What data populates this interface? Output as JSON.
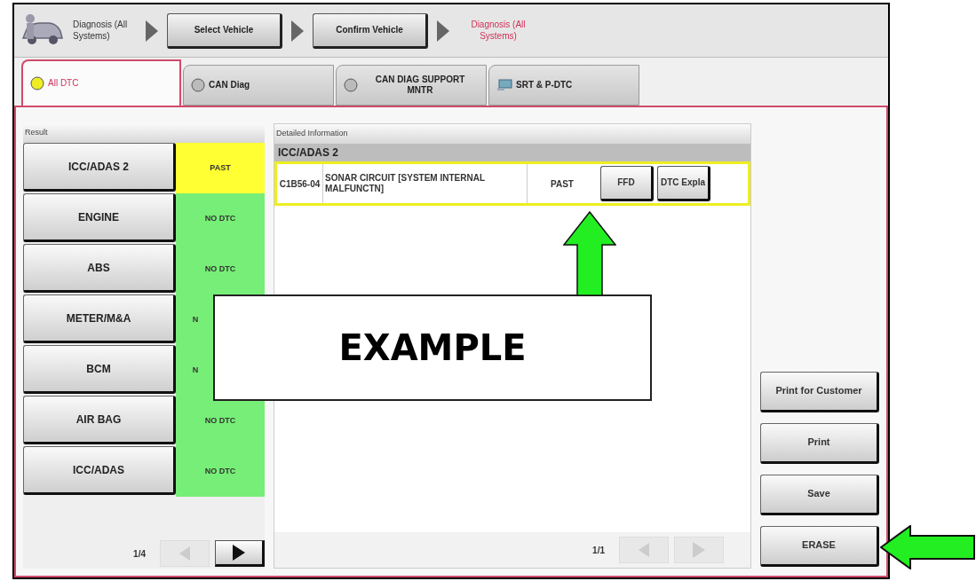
{
  "header": {
    "start_label": "Diagnosis (All Systems)",
    "steps": [
      {
        "label": "Select Vehicle",
        "kind": "button"
      },
      {
        "label": "Confirm Vehicle",
        "kind": "button"
      },
      {
        "label": "Diagnosis (All Systems)",
        "kind": "current"
      }
    ]
  },
  "tabs": [
    {
      "label": "All DTC",
      "selected": true,
      "kind": "lamp"
    },
    {
      "label": "CAN Diag",
      "selected": false,
      "kind": "lamp"
    },
    {
      "label": "CAN DIAG SUPPORT MNTR",
      "selected": false,
      "kind": "lamp"
    },
    {
      "label": "SRT & P-DTC",
      "selected": false,
      "kind": "monitor"
    }
  ],
  "result": {
    "title": "Result",
    "systems": [
      {
        "name": "ICC/ADAS 2",
        "status": "PAST",
        "color": "#ffff33",
        "covered": false
      },
      {
        "name": "ENGINE",
        "status": "NO DTC",
        "color": "#77ee77",
        "covered": false
      },
      {
        "name": "ABS",
        "status": "NO DTC",
        "color": "#77ee77",
        "covered": false
      },
      {
        "name": "METER/M&A",
        "status": "N",
        "color": "#77ee77",
        "covered": true
      },
      {
        "name": "BCM",
        "status": "N",
        "color": "#77ee77",
        "covered": true
      },
      {
        "name": "AIR BAG",
        "status": "NO DTC",
        "color": "#77ee77",
        "covered": false
      },
      {
        "name": "ICC/ADAS",
        "status": "NO DTC",
        "color": "#77ee77",
        "covered": false
      }
    ],
    "pager": {
      "page": "1/4",
      "prev_disabled": true,
      "next_disabled": false
    }
  },
  "detail": {
    "title": "Detailed Information",
    "system": "ICC/ADAS 2",
    "dtcs": [
      {
        "code": "C1B56-04",
        "description": "SONAR CIRCUIT [SYSTEM INTERNAL MALFUNCTN]",
        "status": "PAST",
        "buttons": [
          "FFD",
          "DTC Expla"
        ]
      }
    ],
    "pager": {
      "page": "1/1",
      "prev_disabled": true,
      "next_disabled": true
    }
  },
  "actions": [
    "Print for Customer",
    "Print",
    "Save",
    "ERASE"
  ],
  "annotation": {
    "label": "EXAMPLE"
  }
}
